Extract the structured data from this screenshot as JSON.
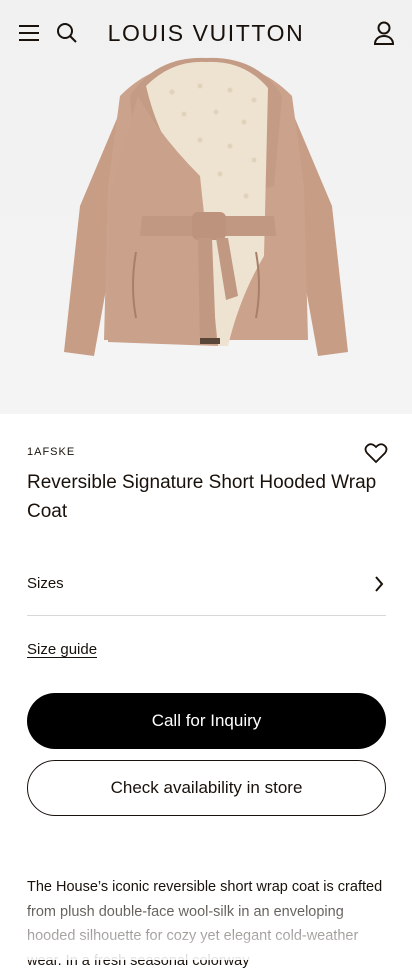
{
  "header": {
    "brand": "LOUIS VUITTON",
    "icons": [
      "menu-icon",
      "search-icon",
      "account-icon"
    ]
  },
  "product": {
    "sku": "1AFSKE",
    "title": "Reversible Signature Short Hooded Wrap Coat",
    "colors": {
      "coat": "#c9a08a",
      "lining": "#ede2cf",
      "background": "#f2f2f2"
    }
  },
  "sizes": {
    "label": "Sizes"
  },
  "size_guide": {
    "label": "Size guide"
  },
  "actions": {
    "primary_label": "Call for Inquiry",
    "secondary_label": "Check availability in store"
  },
  "description": {
    "text": "The House’s iconic reversible short wrap coat is crafted from plush double-face wool-silk in an enveloping hooded silhouette for cozy yet elegant cold-weather wear. In a fresh seasonal colorway"
  }
}
